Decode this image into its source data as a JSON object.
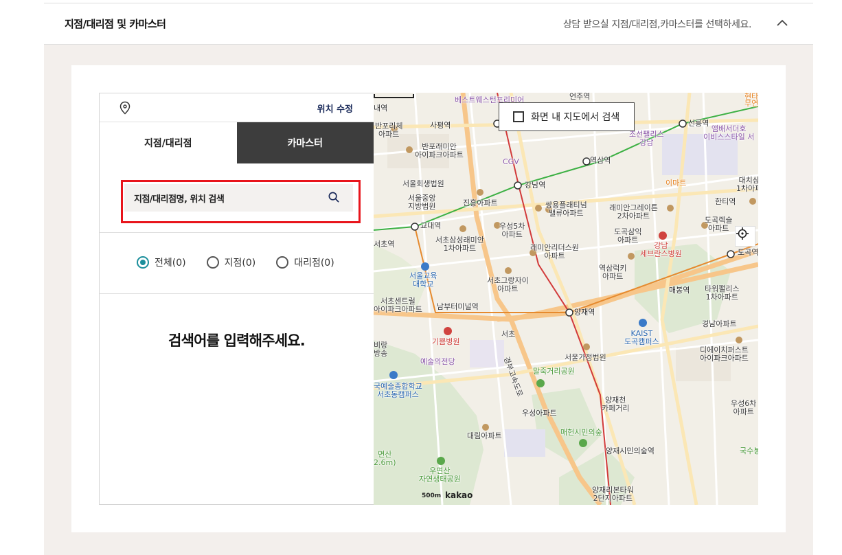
{
  "header": {
    "title": "지점/대리점 및 카마스터",
    "description": "상담 받으실 지점/대리점,카마스터를 선택하세요."
  },
  "panel": {
    "location_edit": "위치 수정",
    "tabs": [
      "지점/대리점",
      "카마스터"
    ],
    "search_placeholder": "지점/대리점명, 위치 검색",
    "filters": [
      {
        "label": "전체(0)",
        "checked": true
      },
      {
        "label": "지점(0)",
        "checked": false
      },
      {
        "label": "대리점(0)",
        "checked": false
      }
    ],
    "empty_message": "검색어를 입력해주세요."
  },
  "map": {
    "in_map_search": "화면 내 지도에서 검색",
    "scale": "500m",
    "provider": "kakao",
    "labels": [
      {
        "text": "베스트웨스턴프리미어",
        "cls": "ml-purple"
      },
      {
        "text": "언주역",
        "cls": "ml-station"
      },
      {
        "text": "현타",
        "cls": "ml-orange"
      },
      {
        "text": "무연",
        "cls": "ml-orange"
      },
      {
        "text": "내역",
        "cls": "ml-station"
      },
      {
        "text": "반포리체\n아파트",
        "cls": "ml-dark"
      },
      {
        "text": "사평역",
        "cls": "ml-station"
      },
      {
        "text": "조선팰리스\n강남",
        "cls": "ml-purple"
      },
      {
        "text": "선릉역",
        "cls": "ml-station"
      },
      {
        "text": "앰배서더호\n이비스스타일 서",
        "cls": "ml-purple"
      },
      {
        "text": "반포래미안\n아이파크아파트",
        "cls": "ml-dark"
      },
      {
        "text": "CGV",
        "cls": "ml-purple"
      },
      {
        "text": "역삼역",
        "cls": "ml-station"
      },
      {
        "text": "서울회생법원",
        "cls": "ml-dark"
      },
      {
        "text": "강남역",
        "cls": "ml-station"
      },
      {
        "text": "이마트",
        "cls": "ml-orange"
      },
      {
        "text": "대치삼\n1차아파",
        "cls": "ml-dark"
      },
      {
        "text": "서울중앙\n지방법원",
        "cls": "ml-dark"
      },
      {
        "text": "진흥아파트",
        "cls": "ml-dark"
      },
      {
        "text": "쌍용플래티넘\n밸류아파트",
        "cls": "ml-dark"
      },
      {
        "text": "래미안그레이튼\n2차아파트",
        "cls": "ml-dark"
      },
      {
        "text": "한티역",
        "cls": "ml-station"
      },
      {
        "text": "교대역",
        "cls": "ml-station"
      },
      {
        "text": "우성5차\n아파트",
        "cls": "ml-dark"
      },
      {
        "text": "도곡렉슬\n아파트",
        "cls": "ml-dark"
      },
      {
        "text": "서초삼성래미안\n1차아파트",
        "cls": "ml-dark"
      },
      {
        "text": "도곡삼익\n아파트",
        "cls": "ml-dark"
      },
      {
        "text": "강남\n세브란스병원",
        "cls": "ml-red"
      },
      {
        "text": "래미안리더스원\n아파트",
        "cls": "ml-dark"
      },
      {
        "text": "도곡역",
        "cls": "ml-station"
      },
      {
        "text": "서초역",
        "cls": "ml-station"
      },
      {
        "text": "서울교육\n대학교",
        "cls": "ml-blue"
      },
      {
        "text": "역삼럭키\n아파트",
        "cls": "ml-dark"
      },
      {
        "text": "서초그랑자이\n아파트",
        "cls": "ml-dark"
      },
      {
        "text": "매봉역",
        "cls": "ml-station"
      },
      {
        "text": "타워팰리스\n1차아파트",
        "cls": "ml-dark"
      },
      {
        "text": "서초센트럴\n아이파크아파트",
        "cls": "ml-dark"
      },
      {
        "text": "남부터미널역",
        "cls": "ml-station"
      },
      {
        "text": "양재역",
        "cls": "ml-station"
      },
      {
        "text": "KAIST\n도곡캠퍼스",
        "cls": "ml-blue"
      },
      {
        "text": "경남아파트",
        "cls": "ml-dark"
      },
      {
        "text": "서초",
        "cls": "ml-dark"
      },
      {
        "text": "기쁨병원",
        "cls": "ml-red"
      },
      {
        "text": "디에이치퍼스트\n아이파크아파트",
        "cls": "ml-dark"
      },
      {
        "text": "비랑\n방송",
        "cls": "ml-dark"
      },
      {
        "text": "예술의전당",
        "cls": "ml-purple"
      },
      {
        "text": "서울가정법원",
        "cls": "ml-dark"
      },
      {
        "text": "말죽거리공원",
        "cls": "ml-green"
      },
      {
        "text": "국예술종합학교\n서초동캠퍼스",
        "cls": "ml-blue"
      },
      {
        "text": "양재천\n카페거리",
        "cls": "ml-dark"
      },
      {
        "text": "우성6차\n아파트",
        "cls": "ml-dark"
      },
      {
        "text": "우성아파트",
        "cls": "ml-dark"
      },
      {
        "text": "대림아파트",
        "cls": "ml-dark"
      },
      {
        "text": "매헌시민의숲",
        "cls": "ml-green"
      },
      {
        "text": "양재시민의숲역",
        "cls": "ml-station"
      },
      {
        "text": "국수봉",
        "cls": "ml-green"
      },
      {
        "text": "면산\n2.6m)",
        "cls": "ml-green"
      },
      {
        "text": "우면산\n자연생태공원",
        "cls": "ml-green"
      },
      {
        "text": "양재리본타워\n2단지아파트",
        "cls": "ml-dark"
      },
      {
        "text": "경부고속도로",
        "cls": "ml-dark"
      }
    ]
  },
  "colors": {
    "accent_teal": "#1c8f9c",
    "highlight_red": "#e8141b",
    "dark_tab": "#3d3d3d",
    "beige_bg": "#f3efec"
  }
}
